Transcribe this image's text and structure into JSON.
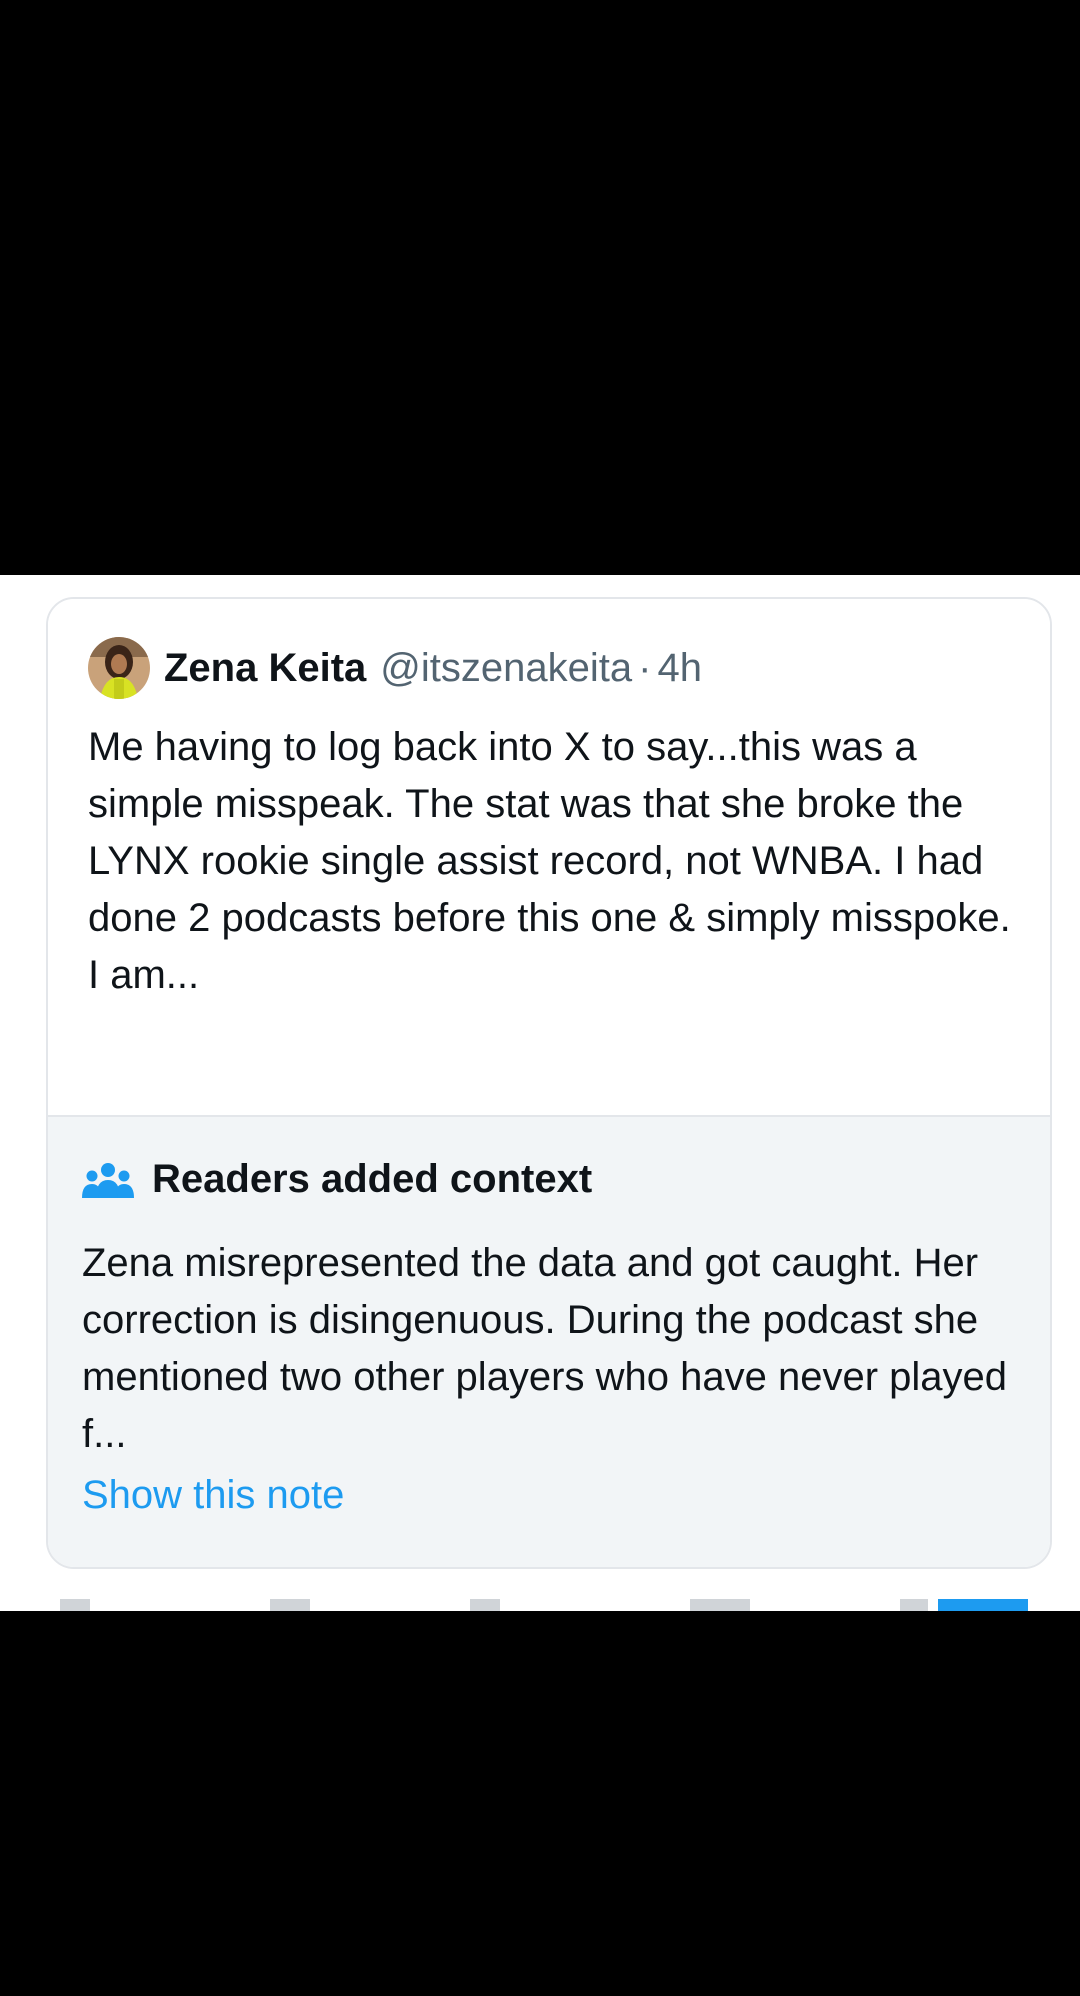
{
  "tweet": {
    "author_name": "Zena Keita",
    "author_handle": "@itszenakeita",
    "separator": "·",
    "time": "4h",
    "text": "Me having to log back into X to say...this was a simple misspeak. The stat was that she broke the LYNX rookie single assist record, not WNBA. I had done 2 podcasts before this one & simply misspoke. I am..."
  },
  "community_note": {
    "icon": "people-icon",
    "title": "Readers added context",
    "text": "Zena misrepresented the data and got caught. Her correction is disingenuous. During the podcast she mentioned two other players who have never played f...",
    "show_note_label": "Show this note"
  },
  "colors": {
    "background": "#000000",
    "panel": "#ffffff",
    "note_background": "#f2f5f7",
    "link": "#1d9bf0",
    "secondary_text": "#536471",
    "people_icon": "#1d9bf0"
  }
}
